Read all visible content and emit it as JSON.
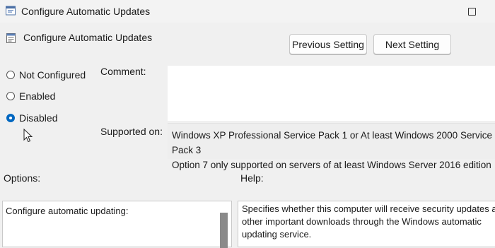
{
  "window": {
    "title": "Configure Automatic Updates"
  },
  "policy": {
    "name": "Configure Automatic Updates"
  },
  "nav": {
    "previous_label": "Previous Setting",
    "next_label": "Next Setting"
  },
  "state": {
    "options": [
      {
        "label": "Not Configured",
        "selected": false
      },
      {
        "label": "Enabled",
        "selected": false
      },
      {
        "label": "Disabled",
        "selected": true
      }
    ]
  },
  "comment": {
    "label": "Comment:",
    "value": ""
  },
  "supported": {
    "label": "Supported on:",
    "lines": [
      "Windows XP Professional Service Pack 1 or At least Windows 2000 Service Pack 3",
      "Option 7 only supported on servers of at least Windows Server 2016 edition"
    ]
  },
  "options_section": {
    "label": "Options:",
    "first_line": "Configure automatic updating:"
  },
  "help_section": {
    "label": "Help:",
    "lines": [
      "Specifies whether this computer will receive security updates and",
      "other important downloads through the Windows automatic",
      "updating service."
    ]
  },
  "colors": {
    "accent": "#0067c0",
    "background": "#f0f0f0"
  }
}
